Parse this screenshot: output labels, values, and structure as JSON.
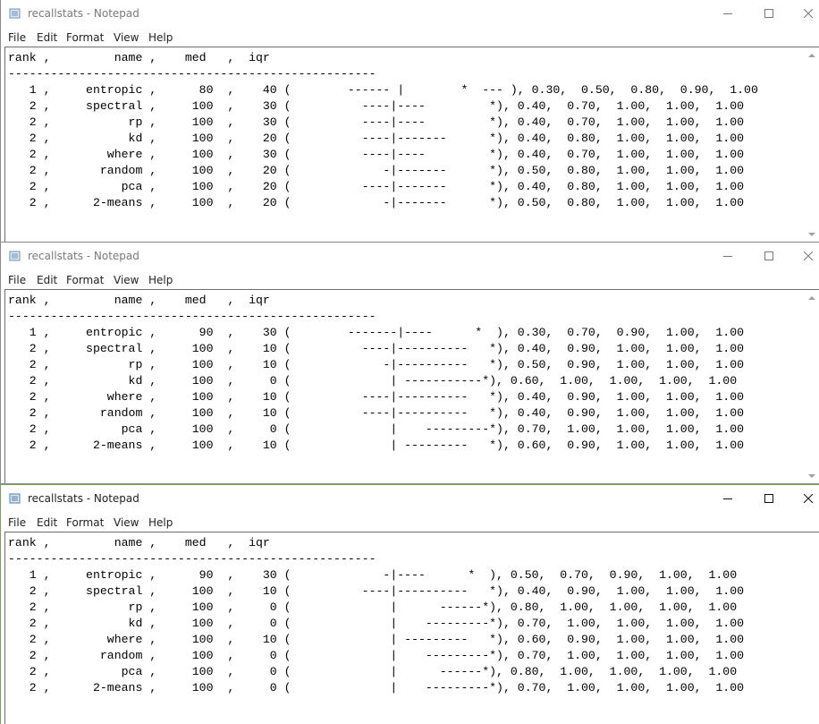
{
  "windows": [
    {
      "title": "recallstats - Notepad",
      "menu": [
        "File",
        "Edit",
        "Format",
        "View",
        "Help"
      ],
      "lines": [
        "rank ,         name ,    med   ,  iqr",
        "----------------------------------------------------",
        "   1 ,     entropic ,      80  ,    40 (        ------ |        *  --- ), 0.30,  0.50,  0.80,  0.90,  1.00",
        "   2 ,     spectral ,     100  ,    30 (          ----|----         *), 0.40,  0.70,  1.00,  1.00,  1.00",
        "   2 ,           rp ,     100  ,    30 (          ----|----         *), 0.40,  0.70,  1.00,  1.00,  1.00",
        "   2 ,           kd ,     100  ,    20 (          ----|-------      *), 0.40,  0.80,  1.00,  1.00,  1.00",
        "   2 ,        where ,     100  ,    30 (          ----|----         *), 0.40,  0.70,  1.00,  1.00,  1.00",
        "   2 ,       random ,     100  ,    20 (             -|-------      *), 0.50,  0.80,  1.00,  1.00,  1.00",
        "   2 ,          pca ,     100  ,    20 (          ----|-------      *), 0.40,  0.80,  1.00,  1.00,  1.00",
        "   2 ,      2-means ,     100  ,    20 (             -|-------      *), 0.50,  0.80,  1.00,  1.00,  1.00"
      ]
    },
    {
      "title": "recallstats - Notepad",
      "menu": [
        "File",
        "Edit",
        "Format",
        "View",
        "Help"
      ],
      "lines": [
        "rank ,         name ,    med   ,  iqr",
        "----------------------------------------------------",
        "   1 ,     entropic ,      90  ,    30 (        -------|----      *  ), 0.30,  0.70,  0.90,  1.00,  1.00",
        "   2 ,     spectral ,     100  ,    10 (          ----|----------   *), 0.40,  0.90,  1.00,  1.00,  1.00",
        "   2 ,           rp ,     100  ,    10 (             -|----------   *), 0.50,  0.90,  1.00,  1.00,  1.00",
        "   2 ,           kd ,     100  ,     0 (              | -----------*), 0.60,  1.00,  1.00,  1.00,  1.00",
        "   2 ,        where ,     100  ,    10 (          ----|----------   *), 0.40,  0.90,  1.00,  1.00,  1.00",
        "   2 ,       random ,     100  ,    10 (          ----|----------   *), 0.40,  0.90,  1.00,  1.00,  1.00",
        "   2 ,          pca ,     100  ,     0 (              |    ---------*), 0.70,  1.00,  1.00,  1.00,  1.00",
        "   2 ,      2-means ,     100  ,    10 (              | ---------   *), 0.60,  0.90,  1.00,  1.00,  1.00"
      ]
    },
    {
      "title": "recallstats - Notepad",
      "menu": [
        "File",
        "Edit",
        "Format",
        "View",
        "Help"
      ],
      "lines": [
        "rank ,         name ,    med   ,  iqr",
        "----------------------------------------------------",
        "   1 ,     entropic ,      90  ,    30 (             -|----      *  ), 0.50,  0.70,  0.90,  1.00,  1.00",
        "   2 ,     spectral ,     100  ,    10 (          ----|----------   *), 0.40,  0.90,  1.00,  1.00,  1.00",
        "   2 ,           rp ,     100  ,     0 (              |      ------*), 0.80,  1.00,  1.00,  1.00,  1.00",
        "   2 ,           kd ,     100  ,     0 (              |    ---------*), 0.70,  1.00,  1.00,  1.00,  1.00",
        "   2 ,        where ,     100  ,    10 (              | ---------   *), 0.60,  0.90,  1.00,  1.00,  1.00",
        "   2 ,       random ,     100  ,     0 (              |    ---------*), 0.70,  1.00,  1.00,  1.00,  1.00",
        "   2 ,          pca ,     100  ,     0 (              |      ------*), 0.80,  1.00,  1.00,  1.00,  1.00",
        "   2 ,      2-means ,     100  ,     0 (              |    ---------*), 0.70,  1.00,  1.00,  1.00,  1.00"
      ]
    }
  ]
}
